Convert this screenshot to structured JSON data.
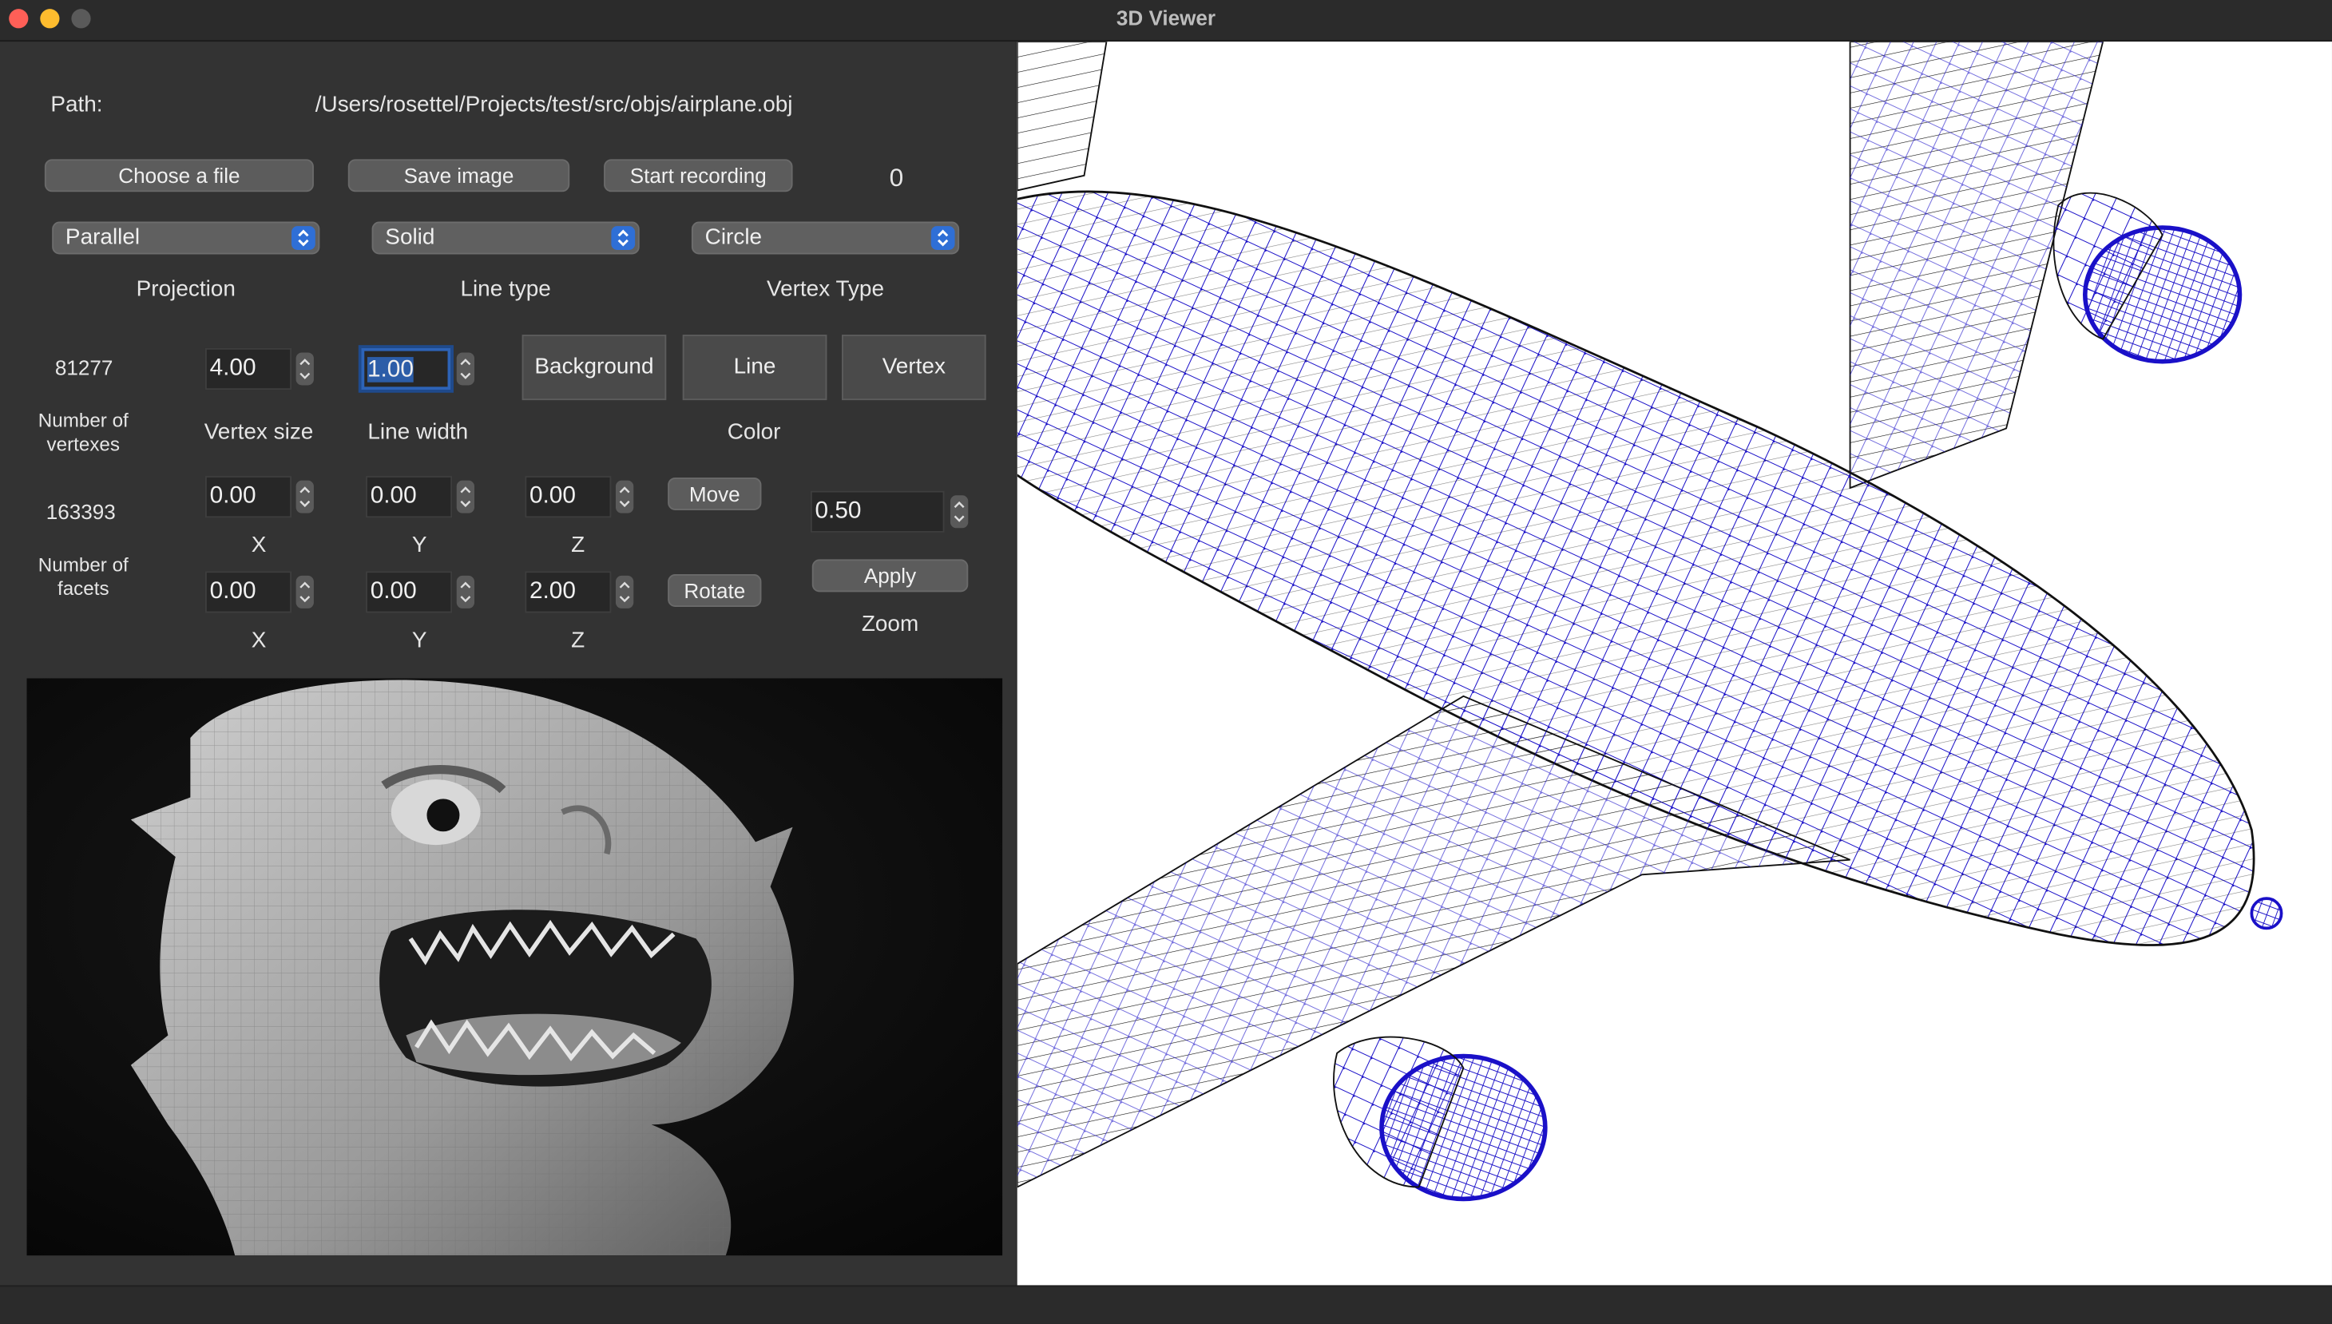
{
  "window": {
    "title": "3D Viewer"
  },
  "path": {
    "label": "Path:",
    "value": "/Users/rosettel/Projects/test/src/objs/airplane.obj"
  },
  "toolbar": {
    "choose_file": "Choose a file",
    "save_image": "Save image",
    "start_recording": "Start recording",
    "recording_counter": "0"
  },
  "dropdowns": {
    "projection": {
      "value": "Parallel",
      "label": "Projection"
    },
    "line_type": {
      "value": "Solid",
      "label": "Line type"
    },
    "vertex_type": {
      "value": "Circle",
      "label": "Vertex Type"
    }
  },
  "stats": {
    "vertex_count": "81277",
    "vertex_count_label": "Number of vertexes",
    "facet_count": "163393",
    "facet_count_label": "Number of facets"
  },
  "sizes": {
    "vertex_size": {
      "value": "4.00",
      "label": "Vertex size"
    },
    "line_width": {
      "value": "1.00",
      "label": "Line width"
    }
  },
  "color": {
    "label": "Color",
    "background_btn": "Background",
    "line_btn": "Line",
    "vertex_btn": "Vertex"
  },
  "move": {
    "x": "0.00",
    "y": "0.00",
    "z": "0.00",
    "button": "Move"
  },
  "rotate": {
    "x": "0.00",
    "y": "0.00",
    "z": "2.00",
    "button": "Rotate"
  },
  "axes": {
    "x": "X",
    "y": "Y",
    "z": "Z"
  },
  "zoom": {
    "value": "0.50",
    "button": "Apply",
    "label": "Zoom"
  },
  "colors": {
    "panel": "#333333",
    "accent": "#2f6fd6",
    "wire_blue": "#1a10c8",
    "viewport_bg": "#ffffff"
  }
}
